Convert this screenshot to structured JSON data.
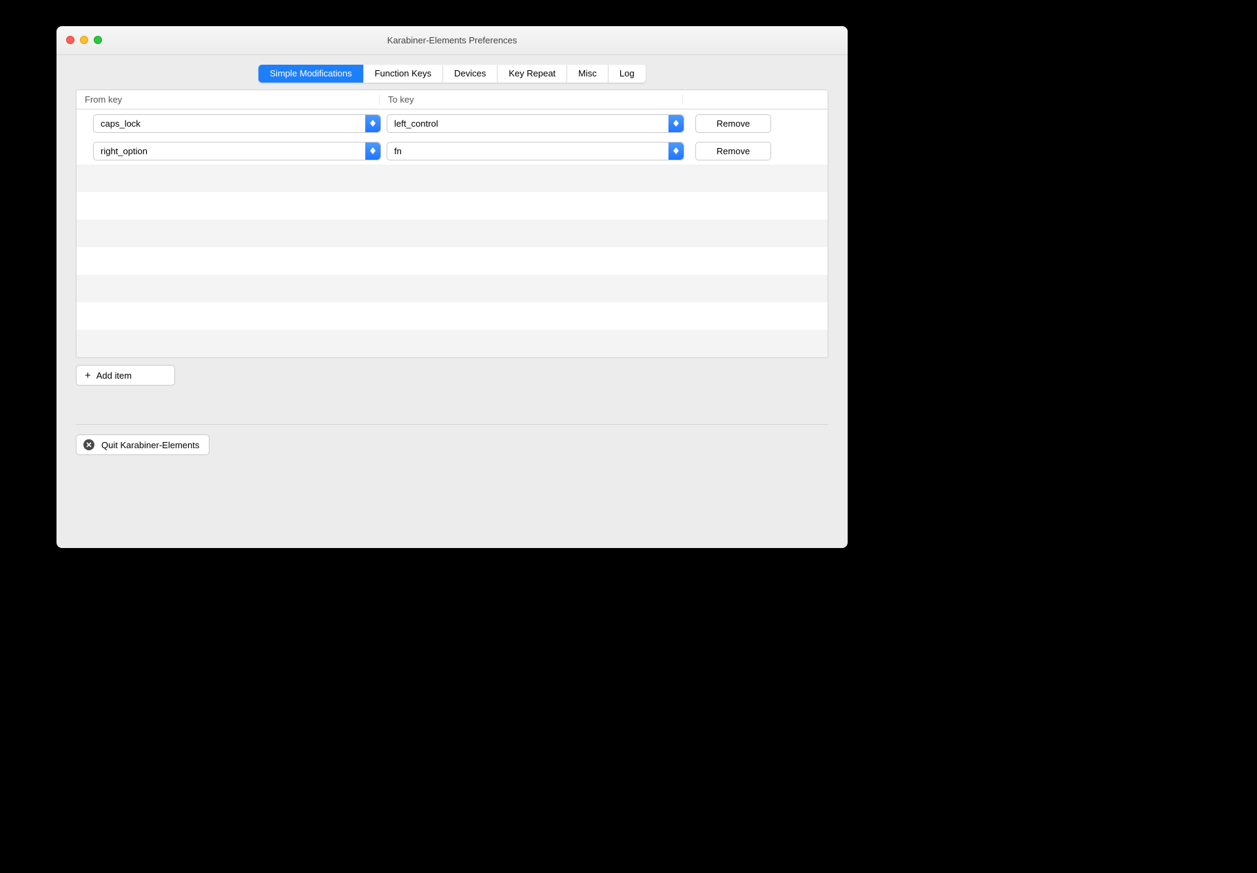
{
  "window": {
    "title": "Karabiner-Elements Preferences"
  },
  "tabs": [
    {
      "label": "Simple Modifications",
      "active": true
    },
    {
      "label": "Function Keys",
      "active": false
    },
    {
      "label": "Devices",
      "active": false
    },
    {
      "label": "Key Repeat",
      "active": false
    },
    {
      "label": "Misc",
      "active": false
    },
    {
      "label": "Log",
      "active": false
    }
  ],
  "columns": {
    "from": "From key",
    "to": "To key"
  },
  "rows": [
    {
      "from": "caps_lock",
      "to": "left_control"
    },
    {
      "from": "right_option",
      "to": "fn"
    }
  ],
  "buttons": {
    "remove": "Remove",
    "add_item": "Add item",
    "quit": "Quit Karabiner-Elements"
  }
}
